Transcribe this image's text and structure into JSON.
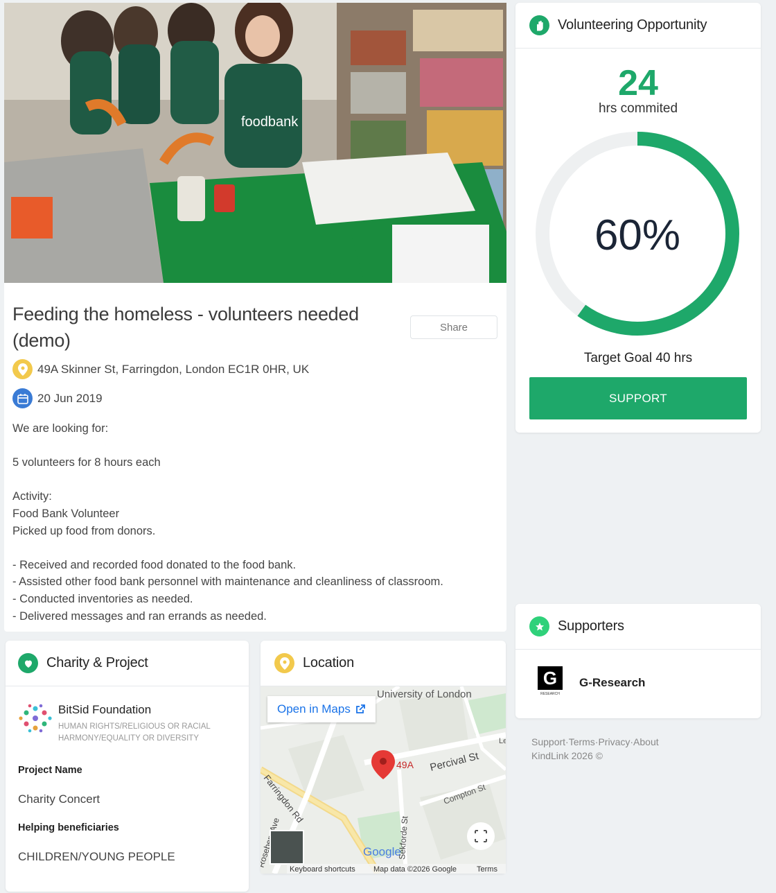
{
  "event": {
    "title": "Feeding the homeless - volunteers needed (demo)",
    "share_label": "Share",
    "address": "49A Skinner St, Farringdon, London EC1R 0HR, UK",
    "date": "20 Jun 2019",
    "description": "We are looking for:\n\n5 volunteers for 8 hours each\n\nActivity:\nFood Bank Volunteer\nPicked up food from donors.\n\n- Received and recorded food donated to the food bank.\n- Assisted other food bank personnel with maintenance and cleanliness of classroom.\n- Conducted inventories as needed.\n- Delivered messages and ran errands as needed.",
    "hero_apron_text": "foodbank"
  },
  "volunteering": {
    "title": "Volunteering Opportunity",
    "hours_value": "24",
    "hours_label": "hrs commited",
    "percent_label": "60%",
    "progress_fraction": 0.6,
    "goal_label": "Target Goal 40 hrs",
    "support_label": "SUPPORT"
  },
  "charity": {
    "title": "Charity & Project",
    "name": "BitSid Foundation",
    "category": "HUMAN RIGHTS/RELIGIOUS OR RACIAL HARMONY/EQUALITY OR DIVERSITY",
    "project_name_label": "Project Name",
    "project_name": "Charity Concert",
    "beneficiaries_label": "Helping beneficiaries",
    "beneficiaries": "CHILDREN/YOUNG PEOPLE"
  },
  "location": {
    "title": "Location",
    "open_maps_label": "Open in Maps",
    "pin_label": "49A",
    "streets": [
      "University of London",
      "Percival St",
      "Compton St",
      "Farringdon Rd",
      "Sekforde St",
      "Rosebery Ave",
      "Le"
    ],
    "google_label": "Google",
    "keyboard_label": "Keyboard shortcuts",
    "mapdata_label": "Map data ©2026 Google",
    "terms_label": "Terms"
  },
  "supporters": {
    "title": "Supporters",
    "items": [
      {
        "name": "G-Research",
        "logo_letter": "G",
        "logo_caption": "RESEARCH"
      }
    ]
  },
  "footer": {
    "links": "Support·Terms·Privacy·About",
    "copyright": "KindLink 2026 ©"
  },
  "colors": {
    "accent": "#1ea86a",
    "location_icon": "#f2c94c",
    "calendar_icon": "#3a7bd5",
    "map_pin": "#e53935",
    "map_link": "#1a73e8"
  },
  "icons": {
    "volunteering": "hand-heart-icon",
    "charity": "charity-leaf-icon",
    "location": "map-pin-icon",
    "calendar": "calendar-icon",
    "supporters": "star-icon",
    "external_link": "external-link-icon",
    "fullscreen": "fullscreen-icon"
  }
}
